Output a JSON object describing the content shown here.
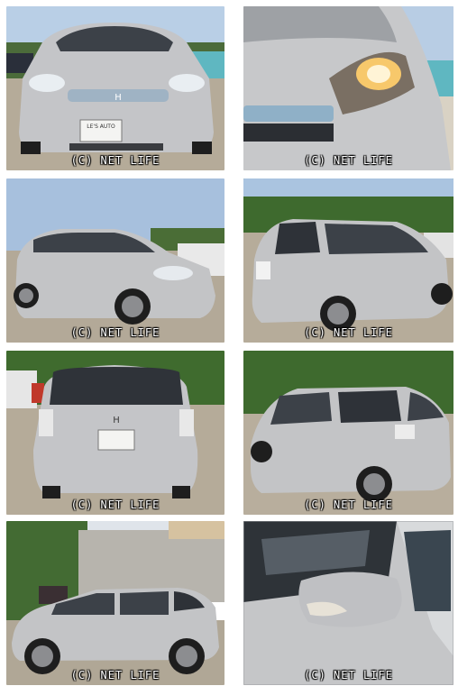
{
  "watermark": "(C) NET LIFE",
  "plate": {
    "front": "LE'S AUTO"
  },
  "colors": {
    "car_silver": "#c2c3c5",
    "sky": "#aac4e0",
    "gravel": "#b7ae9f",
    "foliage": "#3f6b2e",
    "tire": "#1e1e1e"
  },
  "photos": [
    {
      "view": "front"
    },
    {
      "view": "headlight-closeup"
    },
    {
      "view": "front-three-quarter"
    },
    {
      "view": "rear-three-quarter"
    },
    {
      "view": "rear"
    },
    {
      "view": "rear-side"
    },
    {
      "view": "side-profile"
    },
    {
      "view": "mirror-closeup"
    }
  ]
}
